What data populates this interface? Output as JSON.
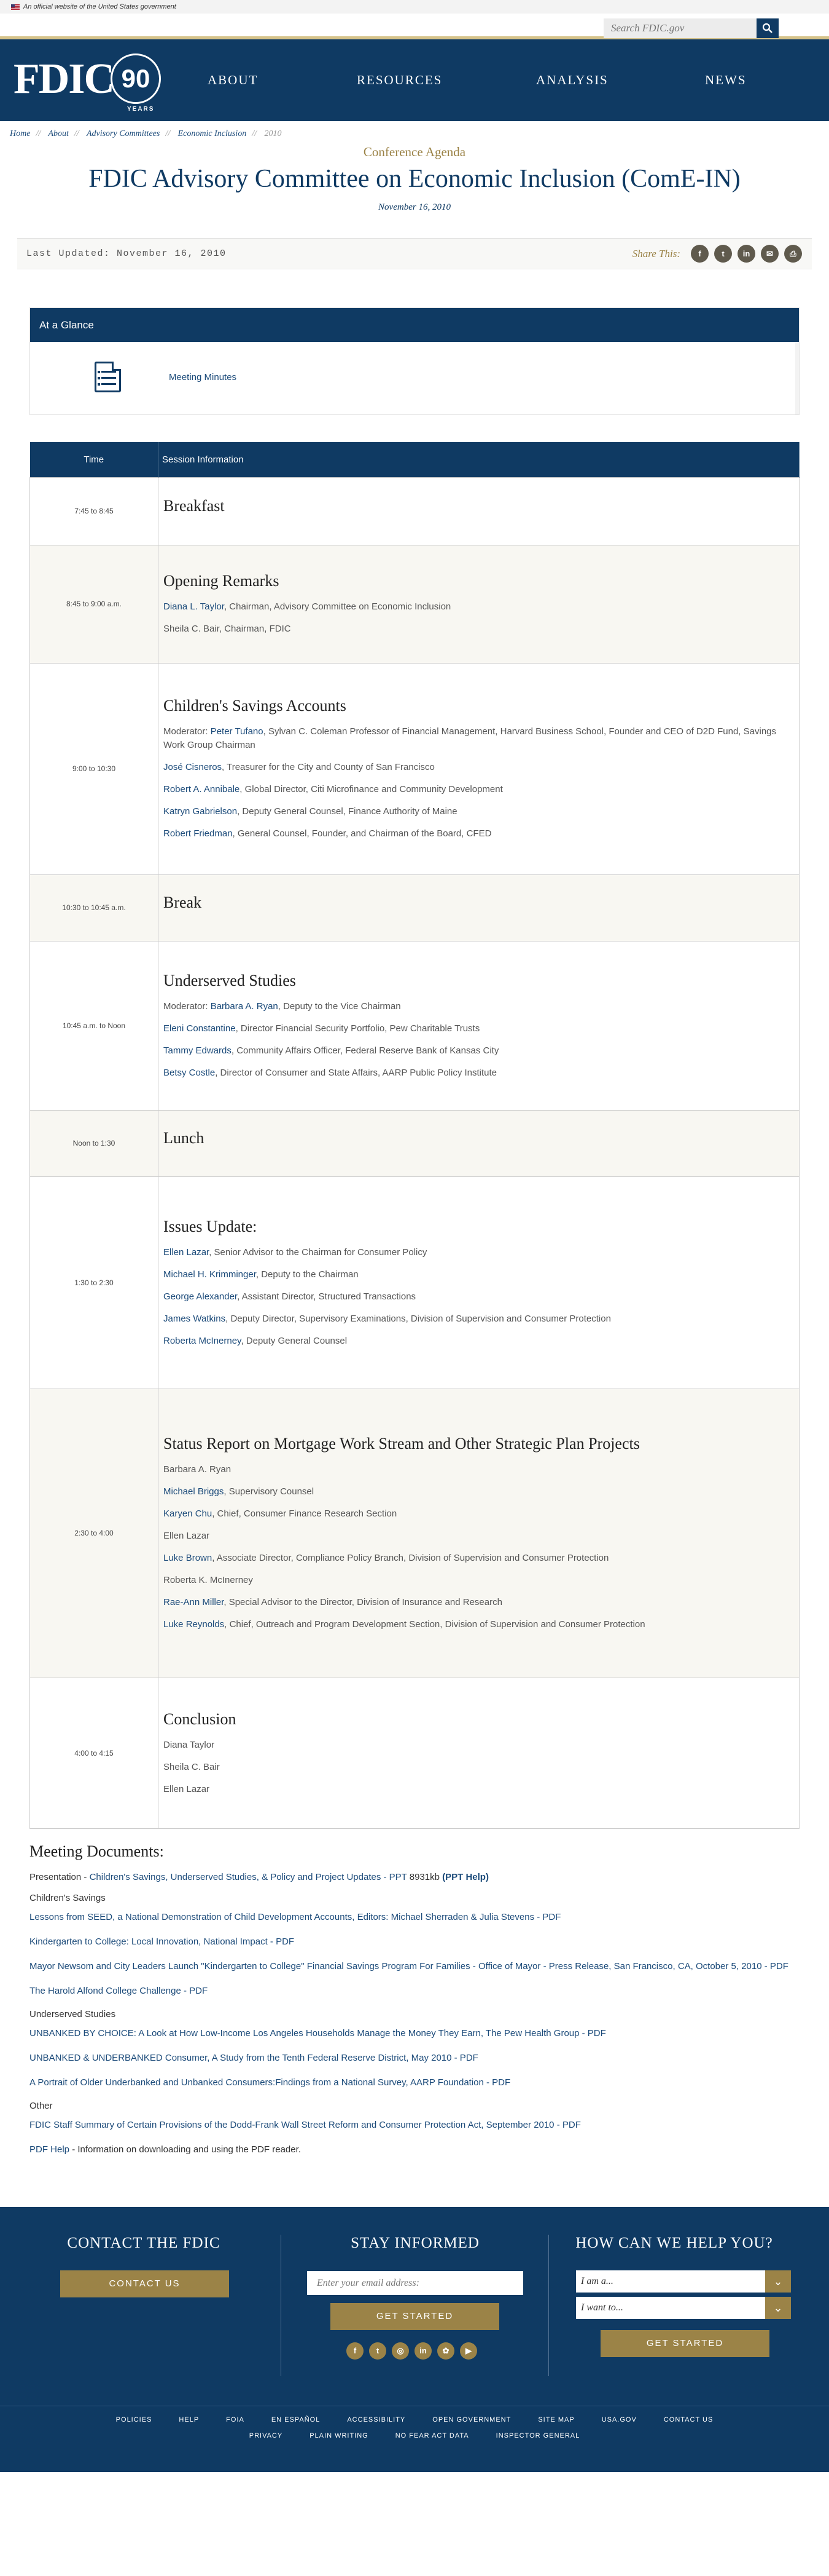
{
  "gov_banner": "An official website of the United States government",
  "search": {
    "placeholder": "Search FDIC.gov"
  },
  "logo": {
    "text": "FDIC",
    "number": "90",
    "years": "YEARS"
  },
  "nav": [
    "ABOUT",
    "RESOURCES",
    "ANALYSIS",
    "NEWS"
  ],
  "breadcrumb": [
    "Home",
    "About",
    "Advisory Committees",
    "Economic Inclusion",
    "2010"
  ],
  "kicker": "Conference Agenda",
  "title": "FDIC Advisory Committee on Economic Inclusion (ComE-IN)",
  "date": "November 16, 2010",
  "last_updated": "Last Updated: November 16, 2010",
  "share_label": "Share This:",
  "share_icons": [
    "f",
    "t",
    "in",
    "✉",
    "⎙"
  ],
  "glance": {
    "heading": "At a Glance",
    "link": "Meeting Minutes"
  },
  "agenda": {
    "headers": {
      "time": "Time",
      "session": "Session Information"
    },
    "rows": [
      {
        "time": "7:45 to 8:45",
        "title": "Breakfast",
        "shade": false,
        "lines": []
      },
      {
        "time": "8:45 to 9:00 a.m.",
        "title": "Opening Remarks",
        "shade": true,
        "lines": [
          {
            "link": "Diana L. Taylor",
            "text": ", Chairman, Advisory Committee on Economic Inclusion"
          },
          {
            "link": "",
            "text": "Sheila C. Bair, Chairman, FDIC"
          }
        ]
      },
      {
        "time": "9:00 to 10:30",
        "title": "Children's Savings Accounts",
        "shade": false,
        "lines": [
          {
            "pre": "Moderator: ",
            "link": "Peter Tufano",
            "text": ", Sylvan C. Coleman Professor of Financial Management, Harvard Business School, Founder and CEO of D2D Fund, Savings Work Group Chairman"
          },
          {
            "link": "José Cisneros",
            "text": ", Treasurer for the City and County of San Francisco"
          },
          {
            "link": "Robert A. Annibale",
            "text": ", Global Director, Citi Microfinance and Community Development"
          },
          {
            "link": "Katryn Gabrielson",
            "text": ", Deputy General Counsel, Finance Authority of Maine"
          },
          {
            "link": "Robert Friedman",
            "text": ", General Counsel, Founder, and Chairman of the Board, CFED"
          }
        ]
      },
      {
        "time": "10:30 to 10:45 a.m.",
        "title": "Break",
        "shade": true,
        "lines": []
      },
      {
        "time": "10:45 a.m. to Noon",
        "title": "Underserved Studies",
        "shade": false,
        "lines": [
          {
            "pre": "Moderator: ",
            "link": "Barbara A. Ryan",
            "text": ", Deputy to the Vice Chairman"
          },
          {
            "link": "Eleni Constantine",
            "text": ", Director Financial Security Portfolio, Pew Charitable Trusts"
          },
          {
            "link": "Tammy Edwards",
            "text": ", Community Affairs Officer, Federal Reserve Bank of Kansas City"
          },
          {
            "link": "Betsy Costle",
            "text": ", Director of Consumer and State Affairs, AARP Public Policy Institute"
          }
        ]
      },
      {
        "time": "Noon to 1:30",
        "title": "Lunch",
        "shade": true,
        "lines": []
      },
      {
        "time": "1:30 to 2:30",
        "title": "Issues Update:",
        "shade": false,
        "lines": [
          {
            "link": "Ellen Lazar",
            "text": ", Senior Advisor to the Chairman for Consumer Policy"
          },
          {
            "link": "Michael H. Krimminger",
            "text": ", Deputy to the Chairman"
          },
          {
            "link": "George Alexander",
            "text": ", Assistant Director, Structured Transactions"
          },
          {
            "link": "James Watkins",
            "text": ", Deputy Director, Supervisory Examinations, Division of Supervision and Consumer Protection"
          },
          {
            "link": "Roberta McInerney",
            "text": ", Deputy General Counsel"
          }
        ]
      },
      {
        "time": "2:30 to 4:00",
        "title": "Status Report on Mortgage Work Stream and Other Strategic Plan Projects",
        "shade": true,
        "lines": [
          {
            "link": "",
            "text": "Barbara A. Ryan"
          },
          {
            "link": "Michael Briggs",
            "text": ", Supervisory Counsel"
          },
          {
            "link": "Karyen Chu",
            "text": ", Chief, Consumer Finance Research Section"
          },
          {
            "link": "",
            "text": "Ellen Lazar"
          },
          {
            "link": "Luke Brown",
            "text": ", Associate Director, Compliance Policy Branch, Division of Supervision and Consumer Protection"
          },
          {
            "link": "",
            "text": "Roberta K. McInerney"
          },
          {
            "link": "Rae-Ann Miller",
            "text": ", Special Advisor to the Director, Division of Insurance and Research"
          },
          {
            "link": "Luke Reynolds",
            "text": ", Chief, Outreach and Program Development Section, Division of Supervision and Consumer Protection"
          }
        ]
      },
      {
        "time": "4:00 to 4:15",
        "title": "Conclusion",
        "shade": false,
        "lines": [
          {
            "link": "",
            "text": "Diana Taylor"
          },
          {
            "link": "",
            "text": "Sheila C. Bair"
          },
          {
            "link": "",
            "text": "Ellen Lazar"
          }
        ]
      }
    ]
  },
  "documents": {
    "heading": "Meeting Documents:",
    "presentation": {
      "pre": "Presentation - ",
      "link": "Children's Savings, Underserved Studies, & Policy and Project Updates - PPT",
      "size": " 8931kb ",
      "help": "(PPT Help)"
    },
    "sections": [
      {
        "name": "Children's Savings",
        "links": [
          "Lessons from SEED, a National Demonstration of Child Development Accounts, Editors: Michael Sherraden & Julia Stevens - PDF",
          "Kindergarten to College: Local Innovation, National Impact - PDF",
          "Mayor Newsom and City Leaders Launch \"Kindergarten to College\" Financial Savings Program For Families - Office of Mayor - Press Release, San Francisco, CA, October 5, 2010 - PDF",
          "The Harold Alfond College Challenge - PDF"
        ]
      },
      {
        "name": "Underserved Studies",
        "links": [
          "UNBANKED BY CHOICE: A Look at How Low-Income Los Angeles Households Manage the Money They Earn, The Pew Health Group - PDF",
          "UNBANKED & UNDERBANKED Consumer, A Study from the Tenth Federal Reserve District, May 2010 - PDF",
          "A Portrait of Older Underbanked and Unbanked Consumers:Findings from a National Survey, AARP Foundation - PDF"
        ]
      },
      {
        "name": "Other",
        "links": [
          "FDIC Staff Summary of Certain Provisions of the Dodd-Frank Wall Street Reform and Consumer Protection Act, September 2010 - PDF"
        ]
      }
    ],
    "pdf_help": {
      "link": "PDF Help",
      "text": " - Information on downloading and using the PDF reader."
    }
  },
  "footer": {
    "contact_heading": "CONTACT THE FDIC",
    "contact_button": "CONTACT US",
    "stay_heading": "STAY INFORMED",
    "email_placeholder": "Enter your email address:",
    "stay_button": "GET STARTED",
    "help_heading": "HOW CAN WE HELP YOU?",
    "select1": "I am a...",
    "select2": "I want to...",
    "help_button": "GET STARTED",
    "social": [
      "f",
      "t",
      "◎",
      "in",
      "✿",
      "▶"
    ],
    "links_row1": [
      "POLICIES",
      "HELP",
      "FOIA",
      "EN ESPAÑOL",
      "ACCESSIBILITY",
      "OPEN GOVERNMENT",
      "SITE MAP",
      "USA.GOV",
      "CONTACT US"
    ],
    "links_row2": [
      "PRIVACY",
      "PLAIN WRITING",
      "NO FEAR ACT DATA",
      "INSPECTOR GENERAL"
    ]
  },
  "colors": {
    "navy": "#0f3a63",
    "gold": "#9b8347",
    "link": "#1c4b7a"
  }
}
